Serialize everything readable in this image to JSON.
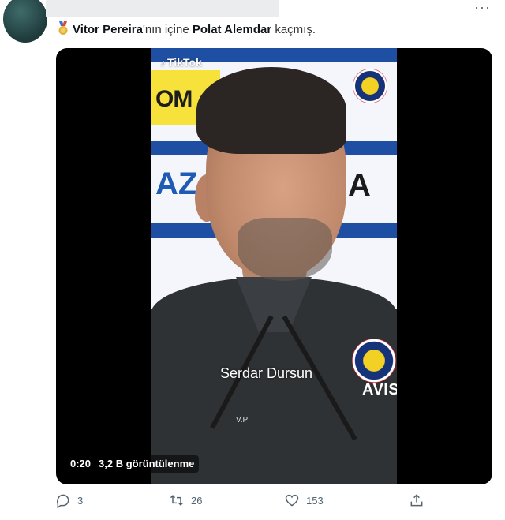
{
  "tweet": {
    "name_part1": "Vitor Pereira",
    "text_part1": "'nın içine ",
    "name_part2": "Polat Alemdar",
    "text_part2": " kaçmış.",
    "medal_icon": "medal-icon"
  },
  "media": {
    "watermark": "TikTok",
    "caption": "Serdar Dursun",
    "small_text": "V.P",
    "shirt_sponsor": "AVIS",
    "board_text_left": "OM",
    "board_text_mid": "AZ",
    "board_text_right": "A",
    "duration": "0:20",
    "views": "3,2 B görüntülenme"
  },
  "actions": {
    "replies": "3",
    "retweets": "26",
    "likes": "153"
  },
  "colors": {
    "text": "#0f1419",
    "muted": "#536471",
    "media_bg": "#000000",
    "fb_blue": "#16337a",
    "fb_yellow": "#f2d024"
  }
}
